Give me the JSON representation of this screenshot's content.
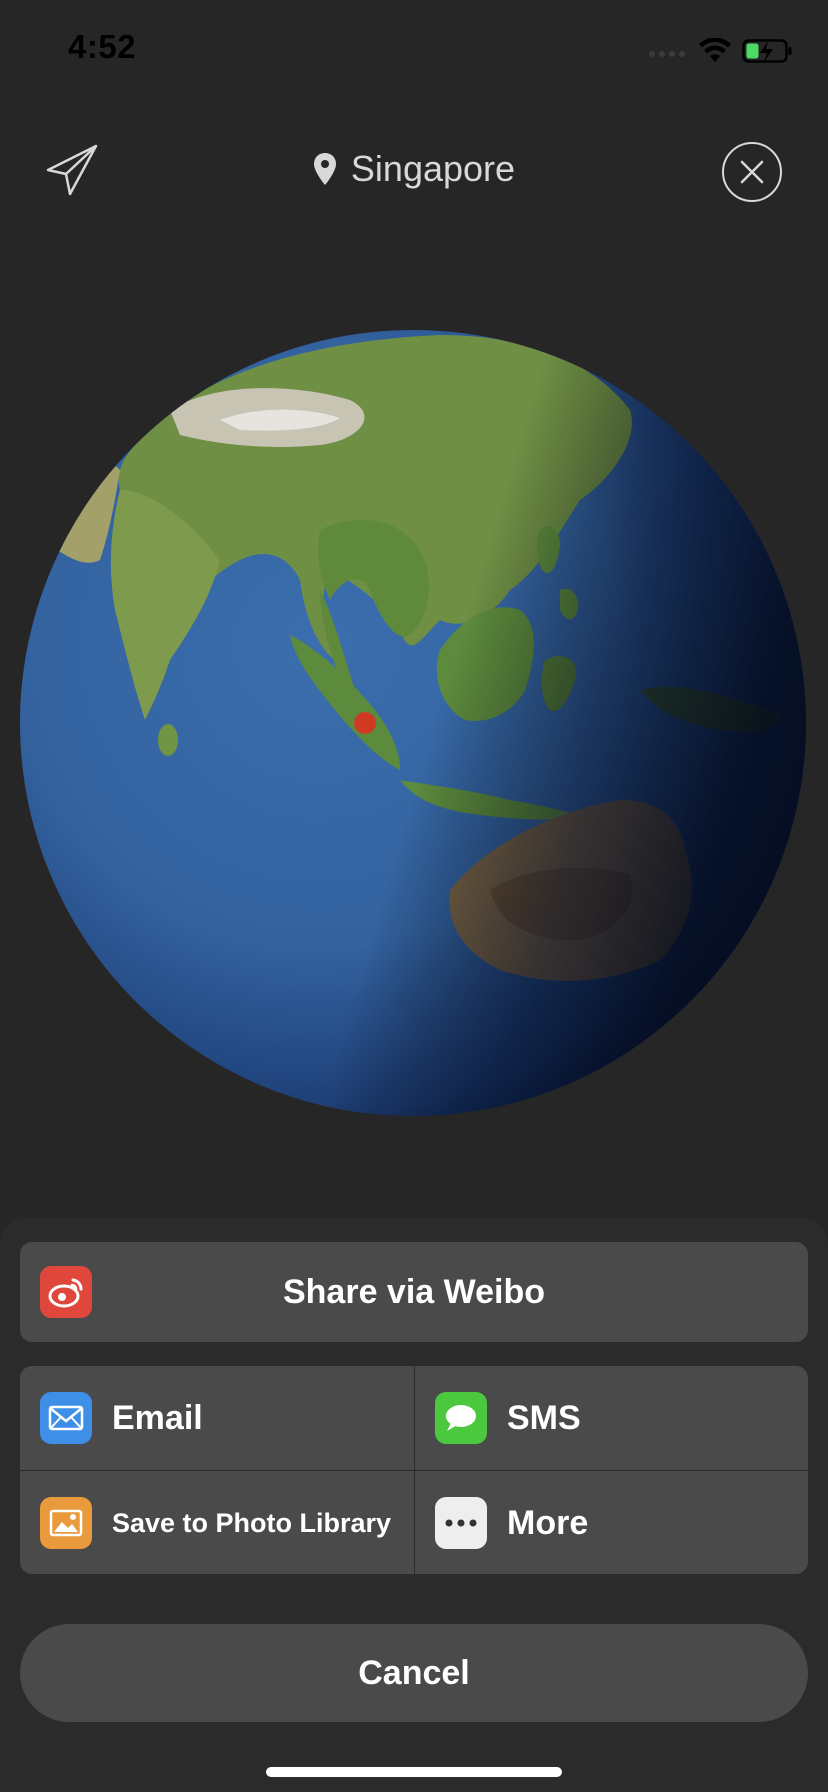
{
  "status_bar": {
    "time": "4:52"
  },
  "header": {
    "location": "Singapore",
    "icons": {
      "send": "paper-plane-icon",
      "location": "location-pin-icon",
      "close": "close-icon"
    }
  },
  "share_sheet": {
    "weibo": {
      "label": "Share via Weibo",
      "icon": "weibo-icon",
      "color": "#e0473c"
    },
    "options": [
      {
        "label": "Email",
        "icon": "mail-icon",
        "color": "#3d8fe8"
      },
      {
        "label": "SMS",
        "icon": "message-bubble-icon",
        "color": "#4cc83f"
      },
      {
        "label": "Save to Photo Library",
        "icon": "photo-icon",
        "color": "#e89a3c"
      },
      {
        "label": "More",
        "icon": "more-dots-icon",
        "color": "#eeeeee"
      }
    ],
    "cancel_label": "Cancel"
  },
  "colors": {
    "background": "#262626",
    "sheet_button": "#4a4a4a",
    "marker": "#d13a22"
  }
}
